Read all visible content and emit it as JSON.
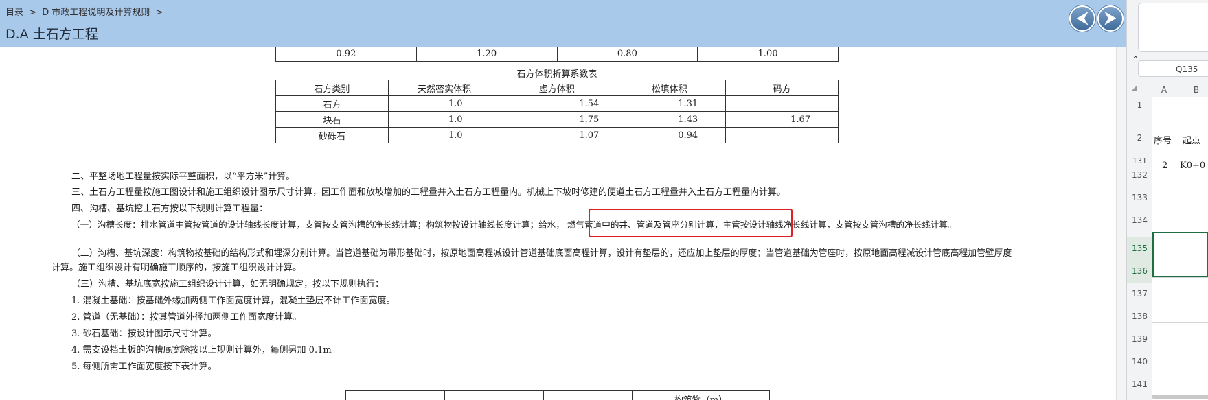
{
  "breadcrumb": {
    "root": "目录",
    "sep": ">",
    "section": "D 市政工程说明及计算规则"
  },
  "page_title": "D.A 土石方工程",
  "nav": {
    "prev": "⮜",
    "next": "⮞"
  },
  "top_table": {
    "row": [
      "0.92",
      "1.20",
      "0.80",
      "1.00"
    ]
  },
  "stone_table": {
    "caption": "石方体积折算系数表",
    "headers": [
      "石方类别",
      "天然密实体积",
      "虚方体积",
      "松填体积",
      "码方"
    ],
    "rows": [
      [
        "石方",
        "1.0",
        "1.54",
        "1.31",
        ""
      ],
      [
        "块石",
        "1.0",
        "1.75",
        "1.43",
        "1.67"
      ],
      [
        "砂砾石",
        "1.0",
        "1.07",
        "0.94",
        ""
      ]
    ]
  },
  "paragraphs": {
    "p2": "二、平整场地工程量按实际平整面积，以“平方米”计算。",
    "p3": "三、土石方工程量按施工图设计和施工组织设计图示尺寸计算，因工作面和放坡增加的工程量并入土石方工程量内。机械上下坡时修建的便道土石方工程量并入土石方工程量内计算。",
    "p4": "四、沟槽、基坑挖土石方按以下规则计算工程量：",
    "p4_1": "（一）沟槽长度：排水管道主管按管道的设计轴线长度计算，支管按支管沟槽的净长线计算；构筑物按设计轴线长度计算；给水， 燃气管道中的井、管道及管座分别计算，主管按设计轴线净长线计算，支管按支管沟槽的净长线计算。",
    "p4_2a": "（二）沟槽、基坑深度：构筑物按基础的结构形式和埋深分别计算。当管道基础为带形基础时，按原地面高程减设计管道基础底面高程计算，设计有垫层的，还应加上垫层的厚度；当管道基础为管座时，按原地面高程减设计管底高程加管壁厚度",
    "p4_2b": "计算。施工组织设计有明确施工顺序的，按施工组织设计计算。",
    "p4_3": "（三）沟槽、基坑底宽按施工组织设计计算，如无明确规定，按以下规则执行：",
    "l1": "1. 混凝土基础：按基础外缘加两侧工作面宽度计算，混凝土垫层不计工作面宽度。",
    "l2": "2. 管道（无基础）：按其管道外径加两侧工作面宽度计算。",
    "l3": "3. 砂石基础：按设计图示尺寸计算。",
    "l4": "4. 需支设挡土板的沟槽底宽除按以上规则计算外，每侧另加 0.1m。",
    "l5": "5. 每侧所需工作面宽度按下表计算。"
  },
  "bottom_table": {
    "partial_header": "构筑物（m）"
  },
  "spreadsheet": {
    "collapse_glyph": "⌃",
    "name_box": "Q135",
    "col_a": "A",
    "col_b": "B",
    "rows": [
      "1",
      "2",
      "131",
      "132",
      "133",
      "134",
      "135",
      "136",
      "137",
      "138",
      "139",
      "140",
      "141"
    ],
    "header_cells": {
      "seq": "序号",
      "start": "起点"
    },
    "data_cells": {
      "seq": "2",
      "start": "K0+0"
    }
  }
}
